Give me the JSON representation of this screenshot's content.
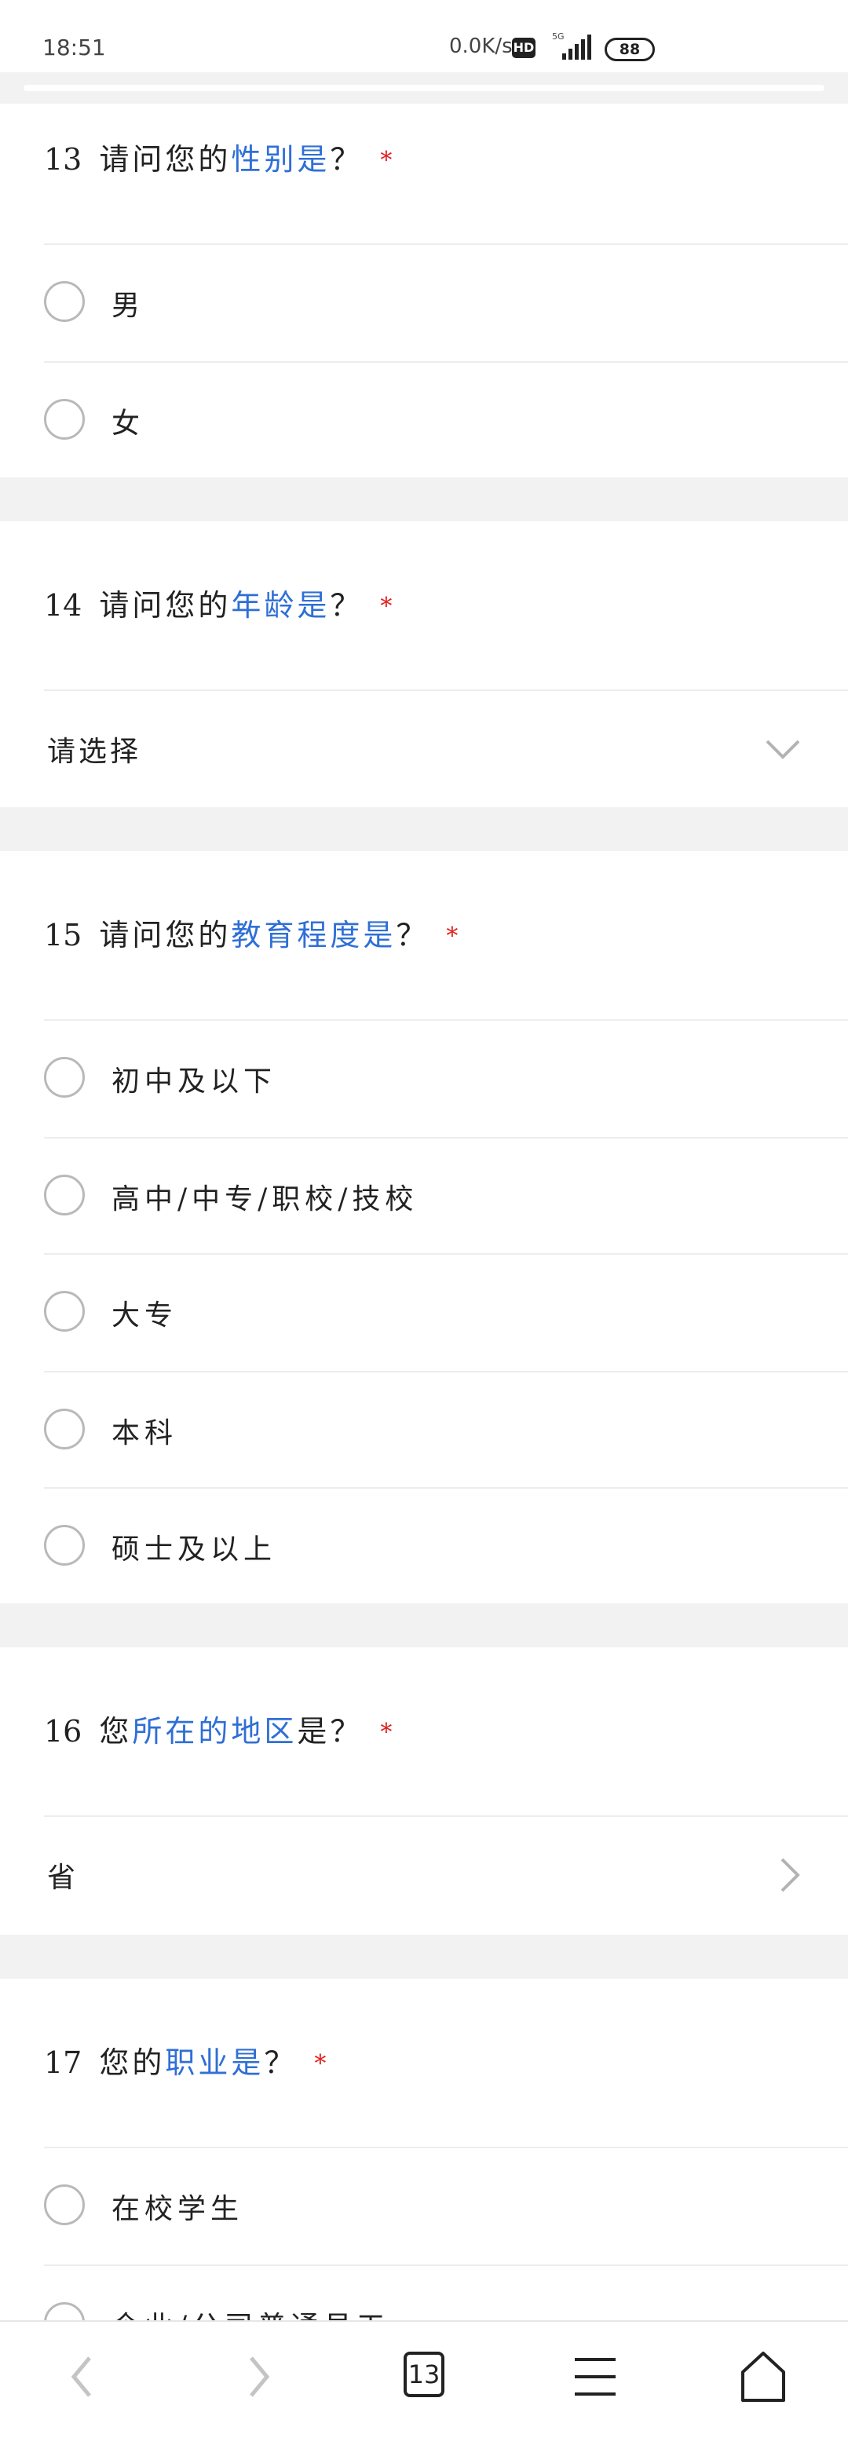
{
  "status_bar": {
    "time": "18:51",
    "network_speed": "0.0K/s",
    "hd_badge": "HD",
    "network_type": "5G",
    "battery": "88"
  },
  "questions": [
    {
      "number": "13",
      "title_before": "请问您的",
      "title_highlight": "性别是",
      "title_after": "？",
      "required_mark": "*",
      "type": "radio",
      "options": [
        "男",
        "女"
      ]
    },
    {
      "number": "14",
      "title_before": "请问您的",
      "title_highlight": "年龄是",
      "title_after": "？",
      "required_mark": "*",
      "type": "select",
      "placeholder": "请选择"
    },
    {
      "number": "15",
      "title_before": "请问您的",
      "title_highlight": "教育程度是",
      "title_after": "？",
      "required_mark": "*",
      "type": "radio",
      "options": [
        "初中及以下",
        "高中/中专/职校/技校",
        "大专",
        "本科",
        "硕士及以上"
      ]
    },
    {
      "number": "16",
      "title_before": "您",
      "title_highlight": "所在的地区",
      "title_after": "是？",
      "required_mark": "*",
      "type": "region",
      "placeholder": "省"
    },
    {
      "number": "17",
      "title_before": "您的",
      "title_highlight": "职业是",
      "title_after": "？",
      "required_mark": "*",
      "type": "radio",
      "options": [
        "在校学生",
        "企业/公司普通员工"
      ]
    }
  ],
  "bottom_nav": {
    "tab_count": "13",
    "icons": [
      "back-arrow-icon",
      "forward-arrow-icon",
      "tabs-icon",
      "menu-icon",
      "home-icon"
    ]
  },
  "colors": {
    "highlight": "#2f6fd6",
    "required": "#e02020",
    "background": "#f2f2f2"
  }
}
